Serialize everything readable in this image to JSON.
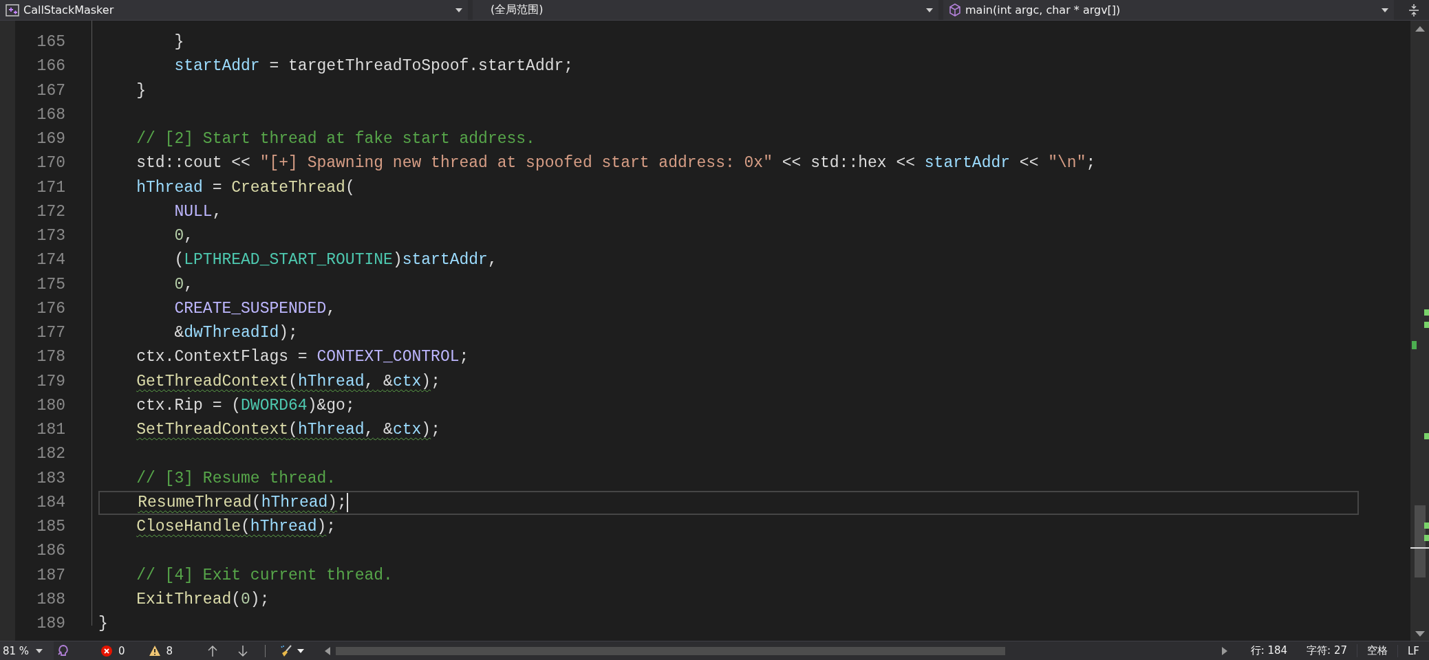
{
  "navigation_bar": {
    "project": "CallStackMasker",
    "scope": "(全局范围)",
    "member": "main(int argc, char * argv[])"
  },
  "editor": {
    "lines": [
      {
        "number": "165",
        "current": false,
        "tokens": [
          {
            "kind": "plain",
            "text": "        }"
          }
        ]
      },
      {
        "number": "166",
        "current": false,
        "tokens": [
          {
            "kind": "variable",
            "text": "        startAddr"
          },
          {
            "kind": "plain",
            "text": " = targetThreadToSpoof.startAddr;"
          }
        ]
      },
      {
        "number": "167",
        "current": false,
        "tokens": [
          {
            "kind": "plain",
            "text": "    }"
          }
        ]
      },
      {
        "number": "168",
        "current": false
      },
      {
        "number": "169",
        "current": false,
        "tokens": [
          {
            "kind": "comment",
            "text": "    // [2] Start thread at fake start address."
          }
        ]
      },
      {
        "number": "170",
        "current": false,
        "tokens": [
          {
            "kind": "plain",
            "text": "    std::cout << "
          },
          {
            "kind": "string",
            "text": "\"[+] Spawning new thread at spoofed start address: 0x\""
          },
          {
            "kind": "plain",
            "text": " << std::hex << "
          },
          {
            "kind": "variable",
            "text": "startAddr"
          },
          {
            "kind": "plain",
            "text": " << "
          },
          {
            "kind": "string",
            "text": "\"\\n\""
          },
          {
            "kind": "plain",
            "text": ";"
          }
        ]
      },
      {
        "number": "171",
        "current": false,
        "tokens": [
          {
            "kind": "variable",
            "text": "    hThread"
          },
          {
            "kind": "plain",
            "text": " = "
          },
          {
            "kind": "function",
            "text": "CreateThread"
          },
          {
            "kind": "plain",
            "text": "("
          }
        ]
      },
      {
        "number": "172",
        "current": false,
        "tokens": [
          {
            "kind": "macro",
            "text": "        NULL"
          },
          {
            "kind": "plain",
            "text": ","
          }
        ]
      },
      {
        "number": "173",
        "current": false,
        "tokens": [
          {
            "kind": "number",
            "text": "        0"
          },
          {
            "kind": "plain",
            "text": ","
          }
        ]
      },
      {
        "number": "174",
        "current": false,
        "tokens": [
          {
            "kind": "plain",
            "text": "        ("
          },
          {
            "kind": "type",
            "text": "LPTHREAD_START_ROUTINE"
          },
          {
            "kind": "plain",
            "text": ")"
          },
          {
            "kind": "variable",
            "text": "startAddr"
          },
          {
            "kind": "plain",
            "text": ","
          }
        ]
      },
      {
        "number": "175",
        "current": false,
        "tokens": [
          {
            "kind": "number",
            "text": "        0"
          },
          {
            "kind": "plain",
            "text": ","
          }
        ]
      },
      {
        "number": "176",
        "current": false,
        "tokens": [
          {
            "kind": "macro",
            "text": "        CREATE_SUSPENDED"
          },
          {
            "kind": "plain",
            "text": ","
          }
        ]
      },
      {
        "number": "177",
        "current": false,
        "tokens": [
          {
            "kind": "plain",
            "text": "        &"
          },
          {
            "kind": "variable",
            "text": "dwThreadId"
          },
          {
            "kind": "plain",
            "text": ");"
          }
        ]
      },
      {
        "number": "178",
        "current": false,
        "tokens": [
          {
            "kind": "plain",
            "text": "    ctx.ContextFlags = "
          },
          {
            "kind": "macro",
            "text": "CONTEXT_CONTROL"
          },
          {
            "kind": "plain",
            "text": ";"
          }
        ]
      },
      {
        "number": "179",
        "current": false,
        "tokens": [
          {
            "kind": "warning",
            "tokens": [
              {
                "kind": "function",
                "text": "    GetThreadContext"
              },
              {
                "kind": "plain",
                "text": "("
              },
              {
                "kind": "variable",
                "text": "hThread"
              },
              {
                "kind": "plain",
                "text": ", &"
              },
              {
                "kind": "variable",
                "text": "ctx"
              },
              {
                "kind": "plain",
                "text": ")"
              }
            ]
          },
          {
            "kind": "plain",
            "text": ";"
          }
        ]
      },
      {
        "number": "180",
        "current": false,
        "tokens": [
          {
            "kind": "plain",
            "text": "    ctx.Rip = ("
          },
          {
            "kind": "type",
            "text": "DWORD64"
          },
          {
            "kind": "plain",
            "text": ")&go;"
          }
        ]
      },
      {
        "number": "181",
        "current": false,
        "tokens": [
          {
            "kind": "warning",
            "tokens": [
              {
                "kind": "function",
                "text": "    SetThreadContext"
              },
              {
                "kind": "plain",
                "text": "("
              },
              {
                "kind": "variable",
                "text": "hThread"
              },
              {
                "kind": "plain",
                "text": ", &"
              },
              {
                "kind": "variable",
                "text": "ctx"
              },
              {
                "kind": "plain",
                "text": ")"
              }
            ]
          },
          {
            "kind": "plain",
            "text": ";"
          }
        ]
      },
      {
        "number": "182",
        "current": false
      },
      {
        "number": "183",
        "current": false,
        "tokens": [
          {
            "kind": "comment",
            "text": "    // [3] Resume thread."
          }
        ]
      },
      {
        "number": "184",
        "current": true,
        "tokens": [
          {
            "kind": "warning",
            "tokens": [
              {
                "kind": "function",
                "text": "    ResumeThread"
              },
              {
                "kind": "plain",
                "text": "("
              },
              {
                "kind": "variable",
                "text": "hThread"
              },
              {
                "kind": "plain",
                "text": ")"
              }
            ]
          },
          {
            "kind": "plain",
            "text": ";"
          }
        ]
      },
      {
        "number": "185",
        "current": false,
        "tokens": [
          {
            "kind": "warning",
            "tokens": [
              {
                "kind": "function",
                "text": "    CloseHandle"
              },
              {
                "kind": "plain",
                "text": "("
              },
              {
                "kind": "variable",
                "text": "hThread"
              },
              {
                "kind": "plain",
                "text": ")"
              }
            ]
          },
          {
            "kind": "plain",
            "text": ";"
          }
        ]
      },
      {
        "number": "186",
        "current": false
      },
      {
        "number": "187",
        "current": false,
        "tokens": [
          {
            "kind": "comment",
            "text": "    // [4] Exit current thread."
          }
        ]
      },
      {
        "number": "188",
        "current": false,
        "tokens": [
          {
            "kind": "function",
            "text": "    ExitThread"
          },
          {
            "kind": "plain",
            "text": "("
          },
          {
            "kind": "number",
            "text": "0"
          },
          {
            "kind": "plain",
            "text": ");"
          }
        ]
      },
      {
        "number": "189",
        "current": false,
        "tokens": [
          {
            "kind": "plain",
            "text": "}"
          }
        ]
      }
    ]
  },
  "status_bar": {
    "zoom": "81 %",
    "errors": "0",
    "warnings": "8",
    "line": "行: 184",
    "column": "字符: 27",
    "indentation": "空格",
    "line_ending": "LF"
  }
}
